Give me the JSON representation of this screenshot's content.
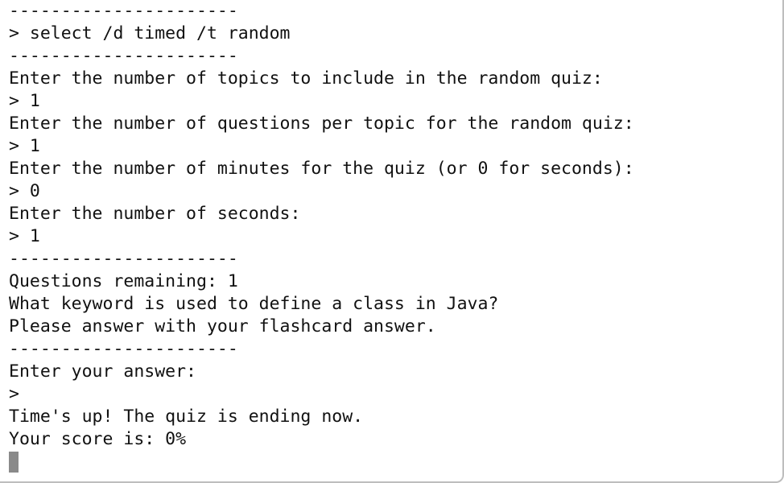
{
  "terminal": {
    "lines": [
      "----------------------",
      "> select /d timed /t random",
      "----------------------",
      "Enter the number of topics to include in the random quiz:",
      "> 1",
      "Enter the number of questions per topic for the random quiz:",
      "> 1",
      "Enter the number of minutes for the quiz (or 0 for seconds):",
      "> 0",
      "Enter the number of seconds:",
      "> 1",
      "----------------------",
      "Questions remaining: 1",
      "What keyword is used to define a class in Java?",
      "Please answer with your flashcard answer.",
      "----------------------",
      "Enter your answer:",
      ">",
      "Time's up! The quiz is ending now.",
      "Your score is: 0%"
    ]
  }
}
